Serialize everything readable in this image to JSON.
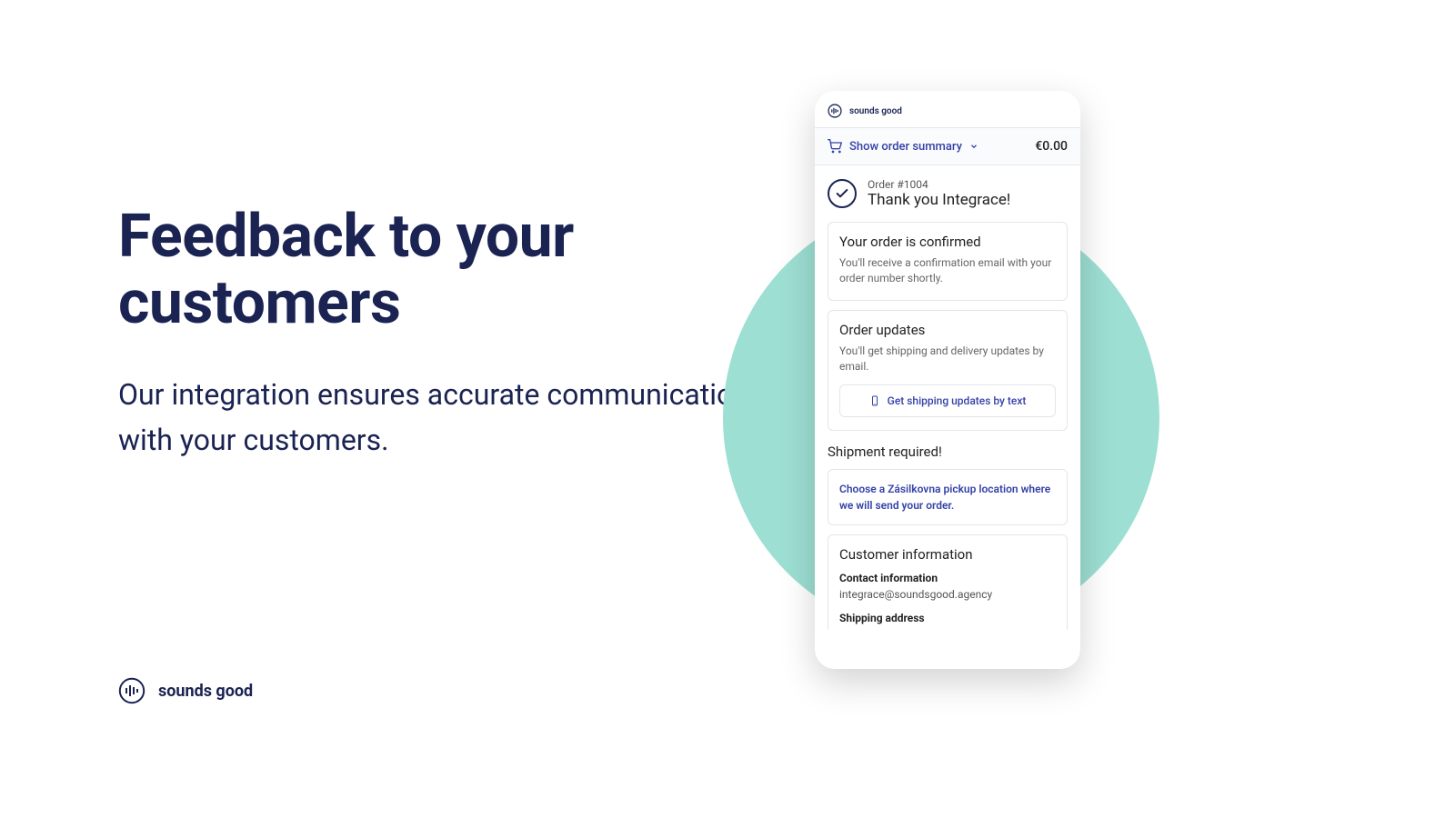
{
  "hero": {
    "headline": "Feedback to your customers",
    "subhead": "Our integration ensures accurate communication with your customers."
  },
  "brand": {
    "name": "sounds good"
  },
  "phone": {
    "brand": "sounds good",
    "summary": {
      "toggle_label": "Show order summary",
      "price": "€0.00"
    },
    "confirm": {
      "order_label": "Order #1004",
      "thanks": "Thank you Integrace!"
    },
    "cards": {
      "confirmed": {
        "title": "Your order is confirmed",
        "desc": "You'll receive a confirmation email with your order number shortly."
      },
      "updates": {
        "title": "Order updates",
        "desc": "You'll get shipping and delivery updates by email.",
        "text_btn": "Get shipping updates by text"
      }
    },
    "shipment": {
      "title": "Shipment required!",
      "pickup_msg": "Choose a Zásilkovna pickup location where we will send your order."
    },
    "customer": {
      "title": "Customer information",
      "contact_label": "Contact information",
      "contact_value": "integrace@soundsgood.agency",
      "shipping_label": "Shipping address"
    }
  }
}
